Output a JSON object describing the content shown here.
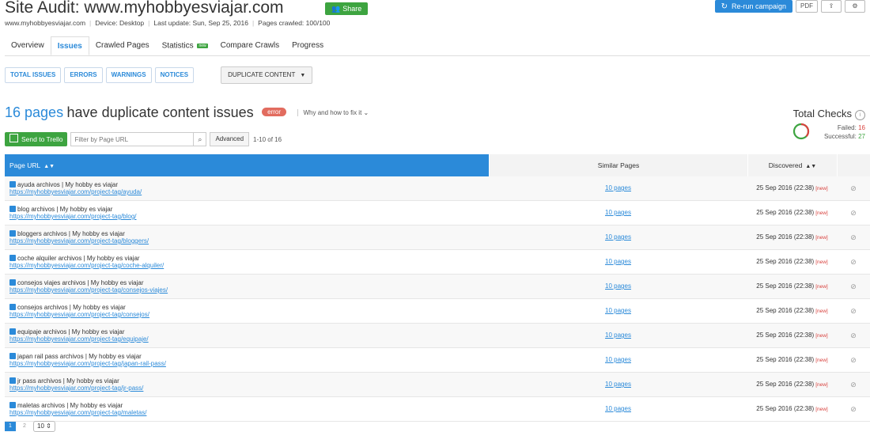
{
  "header": {
    "title": "Site Audit: www.myhobbyesviajar.com",
    "share_label": "Share",
    "rerun_label": "Re-run campaign",
    "pdf_label": "PDF"
  },
  "meta": {
    "domain": "www.myhobbyesviajar.com",
    "device": "Device: Desktop",
    "last_update": "Last update: Sun, Sep 25, 2016",
    "pages_crawled": "Pages crawled: 100/100"
  },
  "tabs": [
    {
      "label": "Overview"
    },
    {
      "label": "Issues",
      "active": true
    },
    {
      "label": "Crawled Pages"
    },
    {
      "label": "Statistics",
      "badge": "new"
    },
    {
      "label": "Compare Crawls"
    },
    {
      "label": "Progress"
    }
  ],
  "filters": {
    "buttons": [
      "TOTAL ISSUES",
      "ERRORS",
      "WARNINGS",
      "NOTICES"
    ],
    "selected": "DUPLICATE CONTENT"
  },
  "headline": {
    "count": "16 pages",
    "rest": "have duplicate content issues",
    "pill": "error",
    "why": "Why and how to fix it"
  },
  "total_checks": {
    "title": "Total Checks",
    "failed_label": "Failed:",
    "failed": "16",
    "successful_label": "Successful:",
    "successful": "27"
  },
  "toolbar": {
    "trello_label": "Send to Trello",
    "filter_placeholder": "Filter by Page URL",
    "advanced_label": "Advanced",
    "range": "1-10 of 16"
  },
  "table": {
    "headers": {
      "url": "Page URL",
      "similar": "Similar Pages",
      "discovered": "Discovered"
    },
    "rows": [
      {
        "title": "ayuda archivos | My hobby es viajar",
        "url": "https://myhobbyesviajar.com/project-tag/ayuda/",
        "similar": "10 pages",
        "date": "25 Sep 2016 (22:38)",
        "tag": "[new]"
      },
      {
        "title": "blog archivos | My hobby es viajar",
        "url": "https://myhobbyesviajar.com/project-tag/blog/",
        "similar": "10 pages",
        "date": "25 Sep 2016 (22:38)",
        "tag": "[new]"
      },
      {
        "title": "bloggers archivos | My hobby es viajar",
        "url": "https://myhobbyesviajar.com/project-tag/bloggers/",
        "similar": "10 pages",
        "date": "25 Sep 2016 (22:38)",
        "tag": "[new]"
      },
      {
        "title": "coche alquiler archivos | My hobby es viajar",
        "url": "https://myhobbyesviajar.com/project-tag/coche-alquiler/",
        "similar": "10 pages",
        "date": "25 Sep 2016 (22:38)",
        "tag": "[new]"
      },
      {
        "title": "consejos viajes archivos | My hobby es viajar",
        "url": "https://myhobbyesviajar.com/project-tag/consejos-viajes/",
        "similar": "10 pages",
        "date": "25 Sep 2016 (22:38)",
        "tag": "[new]"
      },
      {
        "title": "consejos archivos | My hobby es viajar",
        "url": "https://myhobbyesviajar.com/project-tag/consejos/",
        "similar": "10 pages",
        "date": "25 Sep 2016 (22:38)",
        "tag": "[new]"
      },
      {
        "title": "equipaje archivos | My hobby es viajar",
        "url": "https://myhobbyesviajar.com/project-tag/equipaje/",
        "similar": "10 pages",
        "date": "25 Sep 2016 (22:38)",
        "tag": "[new]"
      },
      {
        "title": "japan rail pass archivos | My hobby es viajar",
        "url": "https://myhobbyesviajar.com/project-tag/japan-rail-pass/",
        "similar": "10 pages",
        "date": "25 Sep 2016 (22:38)",
        "tag": "[new]"
      },
      {
        "title": "jr pass archivos | My hobby es viajar",
        "url": "https://myhobbyesviajar.com/project-tag/jr-pass/",
        "similar": "10 pages",
        "date": "25 Sep 2016 (22:38)",
        "tag": "[new]"
      },
      {
        "title": "maletas archivos | My hobby es viajar",
        "url": "https://myhobbyesviajar.com/project-tag/maletas/",
        "similar": "10 pages",
        "date": "25 Sep 2016 (22:38)",
        "tag": "[new]"
      }
    ]
  },
  "pager": {
    "pages": [
      "1",
      "2"
    ],
    "per_page": "10"
  },
  "colors": {
    "accent": "#2b8ad9",
    "success": "#3da440",
    "danger": "#d9433f"
  }
}
